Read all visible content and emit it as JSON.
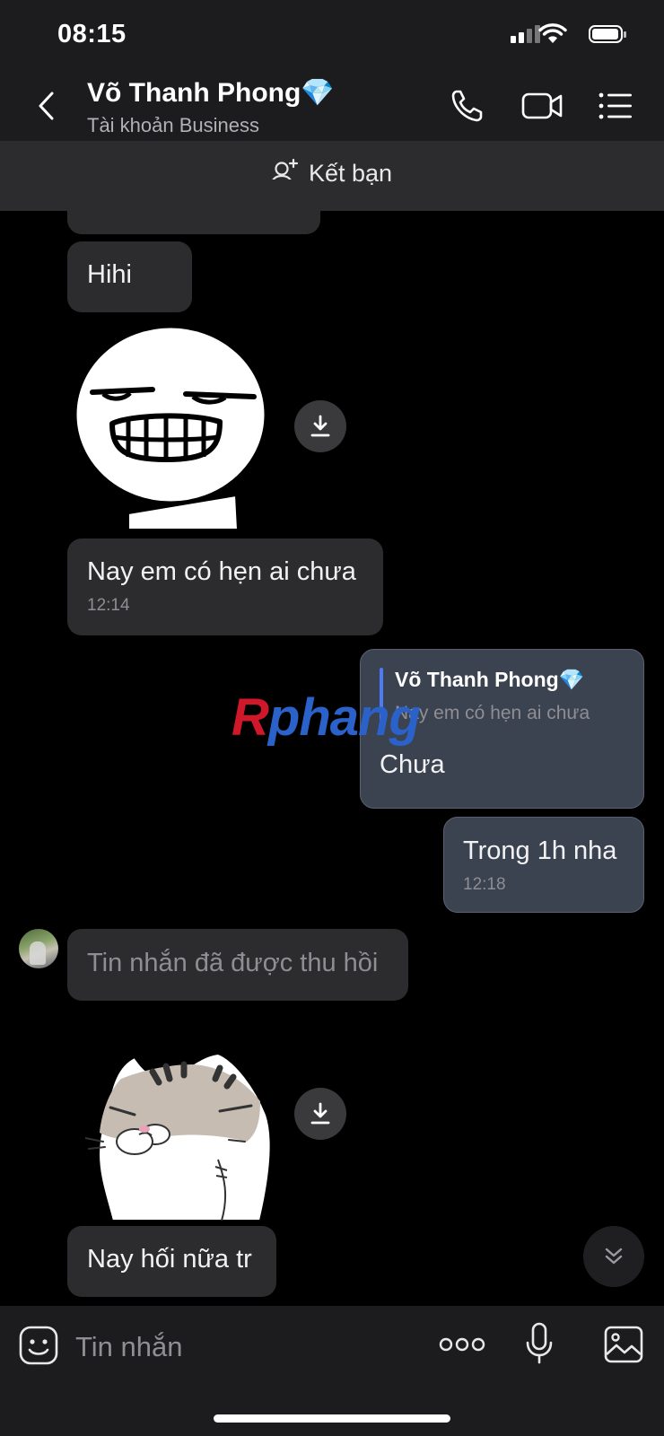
{
  "status": {
    "time": "08:15"
  },
  "header": {
    "name": "Võ Thanh Phong💎",
    "subtitle": "Tài khoản Business"
  },
  "friend_bar": {
    "label": "Kết bạn"
  },
  "messages": [
    {
      "side": "left",
      "type": "text",
      "text": "Hihi"
    },
    {
      "side": "left",
      "type": "sticker",
      "sticker": "grinning-face-sticker"
    },
    {
      "side": "left",
      "type": "text",
      "text": "Nay em có hẹn ai chưa",
      "time": "12:14"
    },
    {
      "side": "right",
      "type": "reply",
      "quote_name": "Võ Thanh Phong💎",
      "quote_text": "Nay em có hẹn ai chưa",
      "text": "Chưa"
    },
    {
      "side": "right",
      "type": "text",
      "text": "Trong 1h nha",
      "time": "12:18"
    },
    {
      "side": "left",
      "type": "recalled",
      "text": "Tin nhắn đã được thu hồi"
    },
    {
      "side": "left",
      "type": "sticker",
      "sticker": "cat-sticker"
    },
    {
      "side": "left",
      "type": "text",
      "text": "Nay hối nữa tr"
    }
  ],
  "watermark": {
    "first": "R",
    "rest": "phang"
  },
  "input": {
    "placeholder": "Tin nhắn"
  },
  "colors": {
    "bubble_left": "#2c2c2e",
    "bubble_right": "#3b4250",
    "accent_quote": "#4c7cf3"
  }
}
